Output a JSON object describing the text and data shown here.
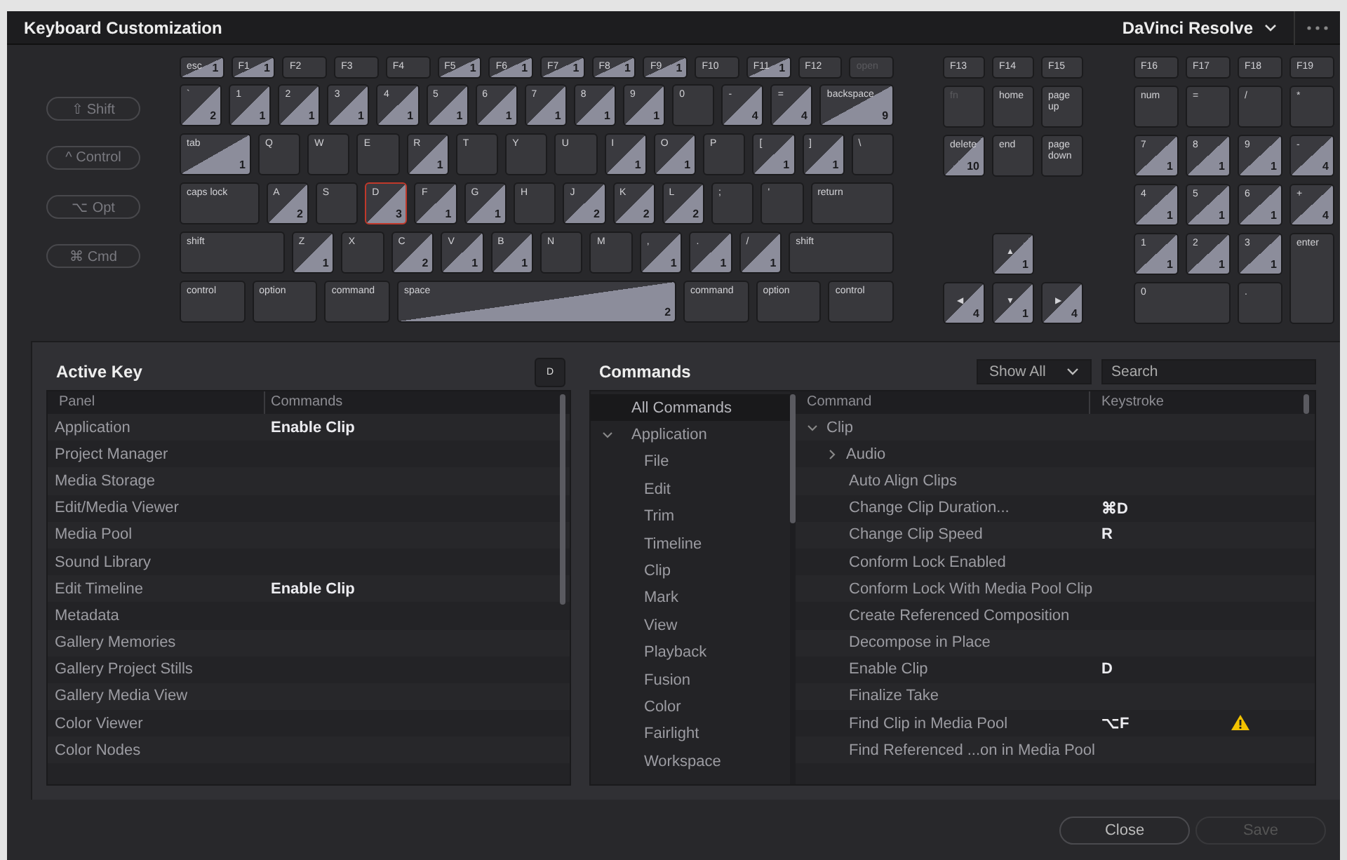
{
  "window": {
    "title": "Keyboard Customization",
    "preset": "DaVinci Resolve"
  },
  "modifiers": [
    {
      "label": "⇧ Shift",
      "selected": false
    },
    {
      "label": "^ Control",
      "selected": false
    },
    {
      "label": "⌥ Opt",
      "selected": false
    },
    {
      "label": "⌘ Cmd",
      "selected": false
    }
  ],
  "keyboard": {
    "function_row": [
      {
        "label": "esc",
        "count": "1",
        "selected": false,
        "disabled": false
      },
      {
        "label": "F1",
        "count": "1",
        "selected": false,
        "disabled": false
      },
      {
        "label": "F2",
        "selected": false,
        "disabled": false
      },
      {
        "label": "F3",
        "selected": false,
        "disabled": false
      },
      {
        "label": "F4",
        "selected": false,
        "disabled": false
      },
      {
        "label": "F5",
        "count": "1",
        "selected": false,
        "disabled": false
      },
      {
        "label": "F6",
        "count": "1",
        "selected": false,
        "disabled": false
      },
      {
        "label": "F7",
        "count": "1",
        "selected": false,
        "disabled": false
      },
      {
        "label": "F8",
        "count": "1",
        "selected": false,
        "disabled": false
      },
      {
        "label": "F9",
        "count": "1",
        "selected": false,
        "disabled": false
      },
      {
        "label": "F10",
        "selected": false,
        "disabled": false
      },
      {
        "label": "F11",
        "count": "1",
        "selected": false,
        "disabled": false
      },
      {
        "label": "F12",
        "selected": false,
        "disabled": false
      },
      {
        "label": "open",
        "selected": false,
        "disabled": true
      }
    ],
    "rows": [
      {
        "keys": [
          {
            "label": "`",
            "count": "2",
            "kind": "key",
            "selected": false,
            "disabled": false
          },
          {
            "label": "1",
            "count": "1",
            "kind": "key",
            "selected": false,
            "disabled": false
          },
          {
            "label": "2",
            "count": "1",
            "kind": "key",
            "selected": false,
            "disabled": false
          },
          {
            "label": "3",
            "count": "1",
            "kind": "key",
            "selected": false,
            "disabled": false
          },
          {
            "label": "4",
            "count": "1",
            "kind": "key",
            "selected": false,
            "disabled": false
          },
          {
            "label": "5",
            "count": "1",
            "kind": "key",
            "selected": false,
            "disabled": false
          },
          {
            "label": "6",
            "count": "1",
            "kind": "key",
            "selected": false,
            "disabled": false
          },
          {
            "label": "7",
            "count": "1",
            "kind": "key",
            "selected": false,
            "disabled": false
          },
          {
            "label": "8",
            "count": "1",
            "kind": "key",
            "selected": false,
            "disabled": false
          },
          {
            "label": "9",
            "count": "1",
            "kind": "key",
            "selected": false,
            "disabled": false
          },
          {
            "label": "0",
            "kind": "key",
            "selected": false,
            "disabled": false
          },
          {
            "label": "-",
            "count": "4",
            "kind": "key",
            "selected": false,
            "disabled": false
          },
          {
            "label": "=",
            "count": "4",
            "kind": "key",
            "selected": false,
            "disabled": false
          },
          {
            "label": "backspace",
            "count": "9",
            "kind": "backspace",
            "selected": false,
            "disabled": false
          }
        ]
      },
      {
        "keys": [
          {
            "label": "tab",
            "count": "1",
            "kind": "tab",
            "selected": false,
            "disabled": false
          },
          {
            "label": "Q",
            "kind": "key",
            "selected": false,
            "disabled": false
          },
          {
            "label": "W",
            "kind": "key",
            "selected": false,
            "disabled": false
          },
          {
            "label": "E",
            "kind": "key",
            "selected": false,
            "disabled": false
          },
          {
            "label": "R",
            "count": "1",
            "kind": "key",
            "selected": false,
            "disabled": false
          },
          {
            "label": "T",
            "kind": "key",
            "selected": false,
            "disabled": false
          },
          {
            "label": "Y",
            "kind": "key",
            "selected": false,
            "disabled": false
          },
          {
            "label": "U",
            "kind": "key",
            "selected": false,
            "disabled": false
          },
          {
            "label": "I",
            "count": "1",
            "kind": "key",
            "selected": false,
            "disabled": false
          },
          {
            "label": "O",
            "count": "1",
            "kind": "key",
            "selected": false,
            "disabled": false
          },
          {
            "label": "P",
            "kind": "key",
            "selected": false,
            "disabled": false
          },
          {
            "label": "[",
            "count": "1",
            "kind": "key",
            "selected": false,
            "disabled": false
          },
          {
            "label": "]",
            "count": "1",
            "kind": "key",
            "selected": false,
            "disabled": false
          },
          {
            "label": "\\",
            "kind": "key",
            "selected": false,
            "disabled": false
          }
        ]
      },
      {
        "keys": [
          {
            "label": "caps lock",
            "kind": "caps",
            "selected": false,
            "disabled": false
          },
          {
            "label": "A",
            "count": "2",
            "kind": "key",
            "selected": false,
            "disabled": false
          },
          {
            "label": "S",
            "kind": "key",
            "selected": false,
            "disabled": false
          },
          {
            "label": "D",
            "count": "3",
            "kind": "key",
            "selected": true,
            "disabled": false
          },
          {
            "label": "F",
            "count": "1",
            "kind": "key",
            "selected": false,
            "disabled": false
          },
          {
            "label": "G",
            "count": "1",
            "kind": "key",
            "selected": false,
            "disabled": false
          },
          {
            "label": "H",
            "kind": "key",
            "selected": false,
            "disabled": false
          },
          {
            "label": "J",
            "count": "2",
            "kind": "key",
            "selected": false,
            "disabled": false
          },
          {
            "label": "K",
            "count": "2",
            "kind": "key",
            "selected": false,
            "disabled": false
          },
          {
            "label": "L",
            "count": "2",
            "kind": "key",
            "selected": false,
            "disabled": false
          },
          {
            "label": ";",
            "kind": "key",
            "selected": false,
            "disabled": false
          },
          {
            "label": "'",
            "kind": "key",
            "selected": false,
            "disabled": false
          },
          {
            "label": "return",
            "kind": "return",
            "selected": false,
            "disabled": false
          }
        ]
      },
      {
        "keys": [
          {
            "label": "shift",
            "kind": "shift",
            "selected": false,
            "disabled": false
          },
          {
            "label": "Z",
            "count": "1",
            "kind": "key",
            "selected": false,
            "disabled": false
          },
          {
            "label": "X",
            "kind": "key",
            "selected": false,
            "disabled": false
          },
          {
            "label": "C",
            "count": "2",
            "kind": "key",
            "selected": false,
            "disabled": false
          },
          {
            "label": "V",
            "count": "1",
            "kind": "key",
            "selected": false,
            "disabled": false
          },
          {
            "label": "B",
            "count": "1",
            "kind": "key",
            "selected": false,
            "disabled": false
          },
          {
            "label": "N",
            "kind": "key",
            "selected": false,
            "disabled": false
          },
          {
            "label": "M",
            "kind": "key",
            "selected": false,
            "disabled": false
          },
          {
            "label": ",",
            "count": "1",
            "kind": "key",
            "selected": false,
            "disabled": false
          },
          {
            "label": ".",
            "count": "1",
            "kind": "key",
            "selected": false,
            "disabled": false
          },
          {
            "label": "/",
            "count": "1",
            "kind": "key",
            "selected": false,
            "disabled": false
          },
          {
            "label": "shift",
            "kind": "shift",
            "selected": false,
            "disabled": false
          }
        ]
      },
      {
        "keys": [
          {
            "label": "control",
            "kind": "modifier",
            "selected": false,
            "disabled": false
          },
          {
            "label": "option",
            "kind": "modifier",
            "selected": false,
            "disabled": false
          },
          {
            "label": "command",
            "kind": "modifier",
            "selected": false,
            "disabled": false
          },
          {
            "label": "space",
            "count": "2",
            "kind": "space",
            "selected": false,
            "disabled": false
          },
          {
            "label": "command",
            "kind": "modifier",
            "selected": false,
            "disabled": false
          },
          {
            "label": "option",
            "kind": "modifier",
            "selected": false,
            "disabled": false
          },
          {
            "label": "control",
            "kind": "modifier",
            "selected": false,
            "disabled": false
          }
        ]
      }
    ],
    "nav_keys": [
      {
        "label": "F13",
        "kind": "function",
        "selected": false,
        "disabled": false
      },
      {
        "label": "F14",
        "kind": "function",
        "selected": false,
        "disabled": false
      },
      {
        "label": "F15",
        "kind": "function",
        "selected": false,
        "disabled": false
      },
      {
        "label": "fn",
        "kind": "key",
        "selected": false,
        "disabled": true
      },
      {
        "label": "home",
        "kind": "key",
        "selected": false,
        "disabled": false
      },
      {
        "label": "page up",
        "kind": "key",
        "selected": false,
        "disabled": false
      },
      {
        "label": "delete",
        "count": "10",
        "kind": "key",
        "selected": false,
        "disabled": false
      },
      {
        "label": "end",
        "kind": "key",
        "selected": false,
        "disabled": false
      },
      {
        "label": "page down",
        "kind": "key",
        "selected": false,
        "disabled": false
      },
      {
        "label": "▲",
        "count": "1",
        "kind": "up",
        "selected": false,
        "disabled": false
      },
      {
        "label": "◀",
        "count": "4",
        "kind": "arrow",
        "selected": false,
        "disabled": false
      },
      {
        "label": "▼",
        "count": "1",
        "kind": "arrow",
        "selected": false,
        "disabled": false
      },
      {
        "label": "▶",
        "count": "4",
        "kind": "arrow",
        "selected": false,
        "disabled": false
      }
    ],
    "numpad_keys": [
      {
        "label": "F16",
        "kind": "function",
        "selected": false,
        "disabled": false
      },
      {
        "label": "F17",
        "kind": "function",
        "selected": false,
        "disabled": false
      },
      {
        "label": "F18",
        "kind": "function",
        "selected": false,
        "disabled": false
      },
      {
        "label": "F19",
        "kind": "function",
        "selected": false,
        "disabled": false
      },
      {
        "label": "num",
        "kind": "key",
        "selected": false,
        "disabled": false
      },
      {
        "label": "=",
        "kind": "key",
        "selected": false,
        "disabled": false
      },
      {
        "label": "/",
        "kind": "key",
        "selected": false,
        "disabled": false
      },
      {
        "label": "*",
        "kind": "key",
        "selected": false,
        "disabled": false
      },
      {
        "label": "7",
        "count": "1",
        "kind": "key",
        "selected": false,
        "disabled": false
      },
      {
        "label": "8",
        "count": "1",
        "kind": "key",
        "selected": false,
        "disabled": false
      },
      {
        "label": "9",
        "count": "1",
        "kind": "key",
        "selected": false,
        "disabled": false
      },
      {
        "label": "-",
        "count": "4",
        "kind": "key",
        "selected": false,
        "disabled": false
      },
      {
        "label": "4",
        "count": "1",
        "kind": "key",
        "selected": false,
        "disabled": false
      },
      {
        "label": "5",
        "count": "1",
        "kind": "key",
        "selected": false,
        "disabled": false
      },
      {
        "label": "6",
        "count": "1",
        "kind": "key",
        "selected": false,
        "disabled": false
      },
      {
        "label": "+",
        "count": "4",
        "kind": "key",
        "selected": false,
        "disabled": false
      },
      {
        "label": "1",
        "count": "1",
        "kind": "key",
        "selected": false,
        "disabled": false
      },
      {
        "label": "2",
        "count": "1",
        "kind": "key",
        "selected": false,
        "disabled": false
      },
      {
        "label": "3",
        "count": "1",
        "kind": "key",
        "selected": false,
        "disabled": false
      },
      {
        "label": "enter",
        "kind": "enter",
        "selected": false,
        "disabled": false
      },
      {
        "label": "0",
        "kind": "zero",
        "selected": false,
        "disabled": false
      },
      {
        "label": ".",
        "kind": "key",
        "selected": false,
        "disabled": false
      }
    ]
  },
  "active_key": {
    "title": "Active Key",
    "key": "D",
    "columns": [
      "Panel",
      "Commands"
    ],
    "rows": [
      {
        "panel": "Application",
        "command": "Enable Clip"
      },
      {
        "panel": "Project Manager"
      },
      {
        "panel": "Media Storage"
      },
      {
        "panel": "Edit/Media Viewer"
      },
      {
        "panel": "Media Pool"
      },
      {
        "panel": "Sound Library"
      },
      {
        "panel": "Edit Timeline",
        "command": "Enable Clip"
      },
      {
        "panel": "Metadata"
      },
      {
        "panel": "Gallery Memories"
      },
      {
        "panel": "Gallery Project Stills"
      },
      {
        "panel": "Gallery Media View"
      },
      {
        "panel": "Color Viewer"
      },
      {
        "panel": "Color Nodes"
      }
    ]
  },
  "commands": {
    "title": "Commands",
    "filter": "Show All",
    "search": {
      "placeholder": "Search"
    },
    "categories": [
      {
        "label": "All Commands",
        "selected": true
      },
      {
        "label": "Application",
        "selected": false,
        "expanded": true,
        "children": [
          {
            "label": "File",
            "selected": false
          },
          {
            "label": "Edit",
            "selected": false
          },
          {
            "label": "Trim",
            "selected": false
          },
          {
            "label": "Timeline",
            "selected": false
          },
          {
            "label": "Clip",
            "selected": false
          },
          {
            "label": "Mark",
            "selected": false
          },
          {
            "label": "View",
            "selected": false
          },
          {
            "label": "Playback",
            "selected": false
          },
          {
            "label": "Fusion",
            "selected": false
          },
          {
            "label": "Color",
            "selected": false
          },
          {
            "label": "Fairlight",
            "selected": false
          },
          {
            "label": "Workspace",
            "selected": false
          }
        ]
      }
    ],
    "columns": [
      "Command",
      "Keystroke"
    ],
    "items": [
      {
        "label": "Clip",
        "expanded": true,
        "children": [
          {
            "label": "Audio",
            "expanded": false,
            "warning": false
          },
          {
            "label": "Auto Align Clips",
            "warning": false
          },
          {
            "label": "Change Clip Duration...",
            "keystroke": "⌘D",
            "warning": false
          },
          {
            "label": "Change Clip Speed",
            "keystroke": "R",
            "warning": false
          },
          {
            "label": "Conform Lock Enabled",
            "warning": false
          },
          {
            "label": "Conform Lock With Media Pool Clip",
            "warning": false
          },
          {
            "label": "Create Referenced Composition",
            "warning": false
          },
          {
            "label": "Decompose in Place",
            "warning": false
          },
          {
            "label": "Enable Clip",
            "keystroke": "D",
            "warning": false
          },
          {
            "label": "Finalize Take",
            "warning": false
          },
          {
            "label": "Find Clip in Media Pool",
            "keystroke": "⌥F",
            "warning": true
          },
          {
            "label": "Find Referenced ...on in Media Pool",
            "warning": false
          }
        ]
      }
    ]
  },
  "buttons": [
    {
      "label": "Close",
      "disabled": false
    },
    {
      "label": "Save",
      "disabled": true
    }
  ]
}
